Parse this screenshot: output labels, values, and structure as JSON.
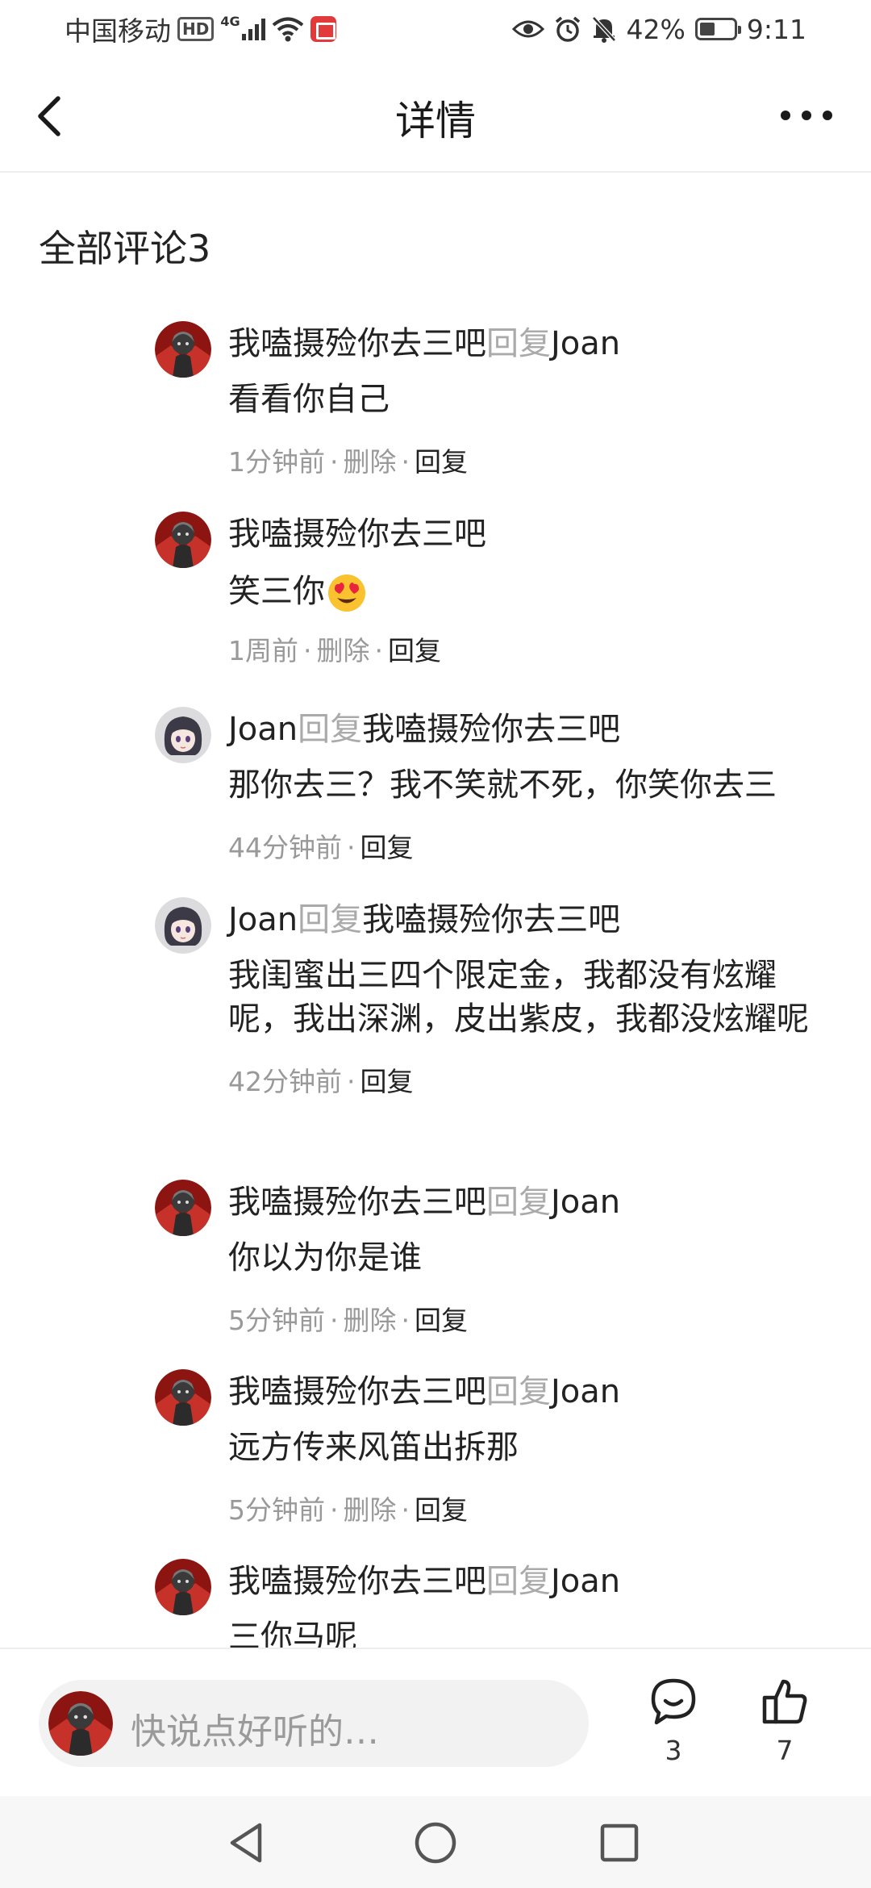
{
  "status_bar": {
    "carrier": "中国移动",
    "hd": "HD",
    "network": "4G",
    "battery": "42%",
    "time": "9:11"
  },
  "header": {
    "title": "详情"
  },
  "section": {
    "title": "全部评论3"
  },
  "comments": [
    {
      "author": "我嗑摄殓你去三吧",
      "reply_word": "回复",
      "reply_to": "Joan",
      "text": "看看你自己",
      "time": "1分钟前",
      "delete": "删除",
      "reply": "回复",
      "avatar": "dark-avatar"
    },
    {
      "author": "我嗑摄殓你去三吧",
      "text": "笑三你",
      "emoji": "heart-eyes-emoji",
      "time": "1周前",
      "delete": "删除",
      "reply": "回复",
      "avatar": "dark-avatar"
    },
    {
      "author": "Joan",
      "reply_word": "回复",
      "reply_to": "我嗑摄殓你去三吧",
      "text": "那你去三？我不笑就不死，你笑你去三",
      "time": "44分钟前",
      "reply": "回复",
      "avatar": "anime-girl-avatar"
    },
    {
      "author": "Joan",
      "reply_word": "回复",
      "reply_to": "我嗑摄殓你去三吧",
      "text": "我闺蜜出三四个限定金，我都没有炫耀呢，我出深渊，皮出紫皮，我都没炫耀呢",
      "time": "42分钟前",
      "reply": "回复",
      "avatar": "anime-girl-avatar"
    },
    {
      "author": "我嗑摄殓你去三吧",
      "reply_word": "回复",
      "reply_to": "Joan",
      "text": "你以为你是谁",
      "time": "5分钟前",
      "delete": "删除",
      "reply": "回复",
      "avatar": "dark-avatar"
    },
    {
      "author": "我嗑摄殓你去三吧",
      "reply_word": "回复",
      "reply_to": "Joan",
      "text": "远方传来风笛出拆那",
      "time": "5分钟前",
      "delete": "删除",
      "reply": "回复",
      "avatar": "dark-avatar"
    },
    {
      "author": "我嗑摄殓你去三吧",
      "reply_word": "回复",
      "reply_to": "Joan",
      "text": "三你马呢",
      "avatar": "dark-avatar"
    }
  ],
  "bottom_bar": {
    "placeholder": "快说点好听的…",
    "comment_count": "3",
    "like_count": "7"
  },
  "icons": {
    "back": "chevron-left-icon",
    "more": "more-dots-icon",
    "comment": "comment-bubble-icon",
    "like": "thumbs-up-icon"
  },
  "colors": {
    "reply_word": "#aaaaaa",
    "meta": "#999999",
    "input_bg": "#f2f2f2",
    "avatar_red": "#b3241e"
  }
}
